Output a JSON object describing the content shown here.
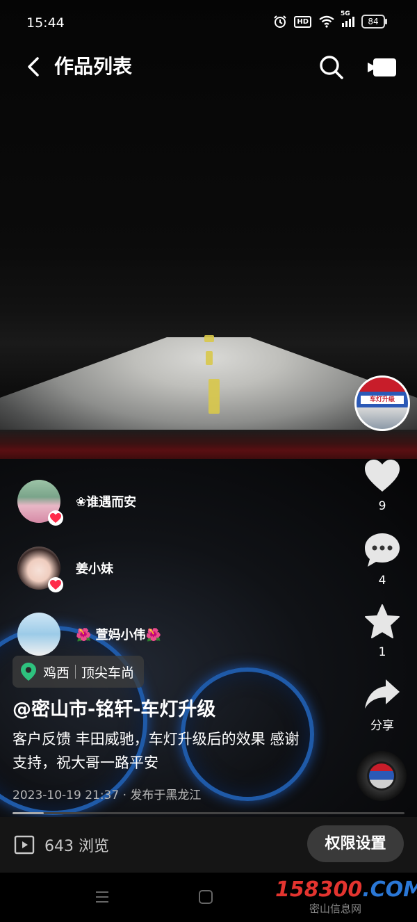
{
  "status_bar": {
    "time": "15:44",
    "hd": "HD",
    "network": "5G",
    "battery": "84"
  },
  "header": {
    "title": "作品列表",
    "back_icon": "chevron-left-icon",
    "search_icon": "search-icon",
    "camera_icon": "video-camera-icon"
  },
  "shop_avatar": {
    "sign_text": "车灯升级"
  },
  "actions": {
    "like_count": "9",
    "comment_count": "4",
    "favorite_count": "1",
    "share_label": "分享"
  },
  "likers": [
    {
      "name": "❀谁遇而安"
    },
    {
      "name": "姜小妹"
    },
    {
      "name": "🌺 萱妈小伟🌺"
    }
  ],
  "location": {
    "city": "鸡西",
    "place": "顶尖车尚"
  },
  "post": {
    "author": "@密山市-铭轩-车灯升级",
    "description": "客户反馈 丰田威驰，车灯升级后的效果 感谢支持，祝大哥一路平安",
    "meta": "2023-10-19 21:37 · 发布于黑龙江",
    "progress": 0.08
  },
  "bottom": {
    "views": "643 浏览",
    "permission_button": "权限设置"
  },
  "watermark": {
    "main": "158300",
    "suffix": ".COM",
    "sub": "密山信息网"
  },
  "colors": {
    "heart_red": "#ff2b4a",
    "location_green": "#2ec27e",
    "watermark_red": "#e3342f",
    "watermark_blue": "#2a77d6"
  }
}
